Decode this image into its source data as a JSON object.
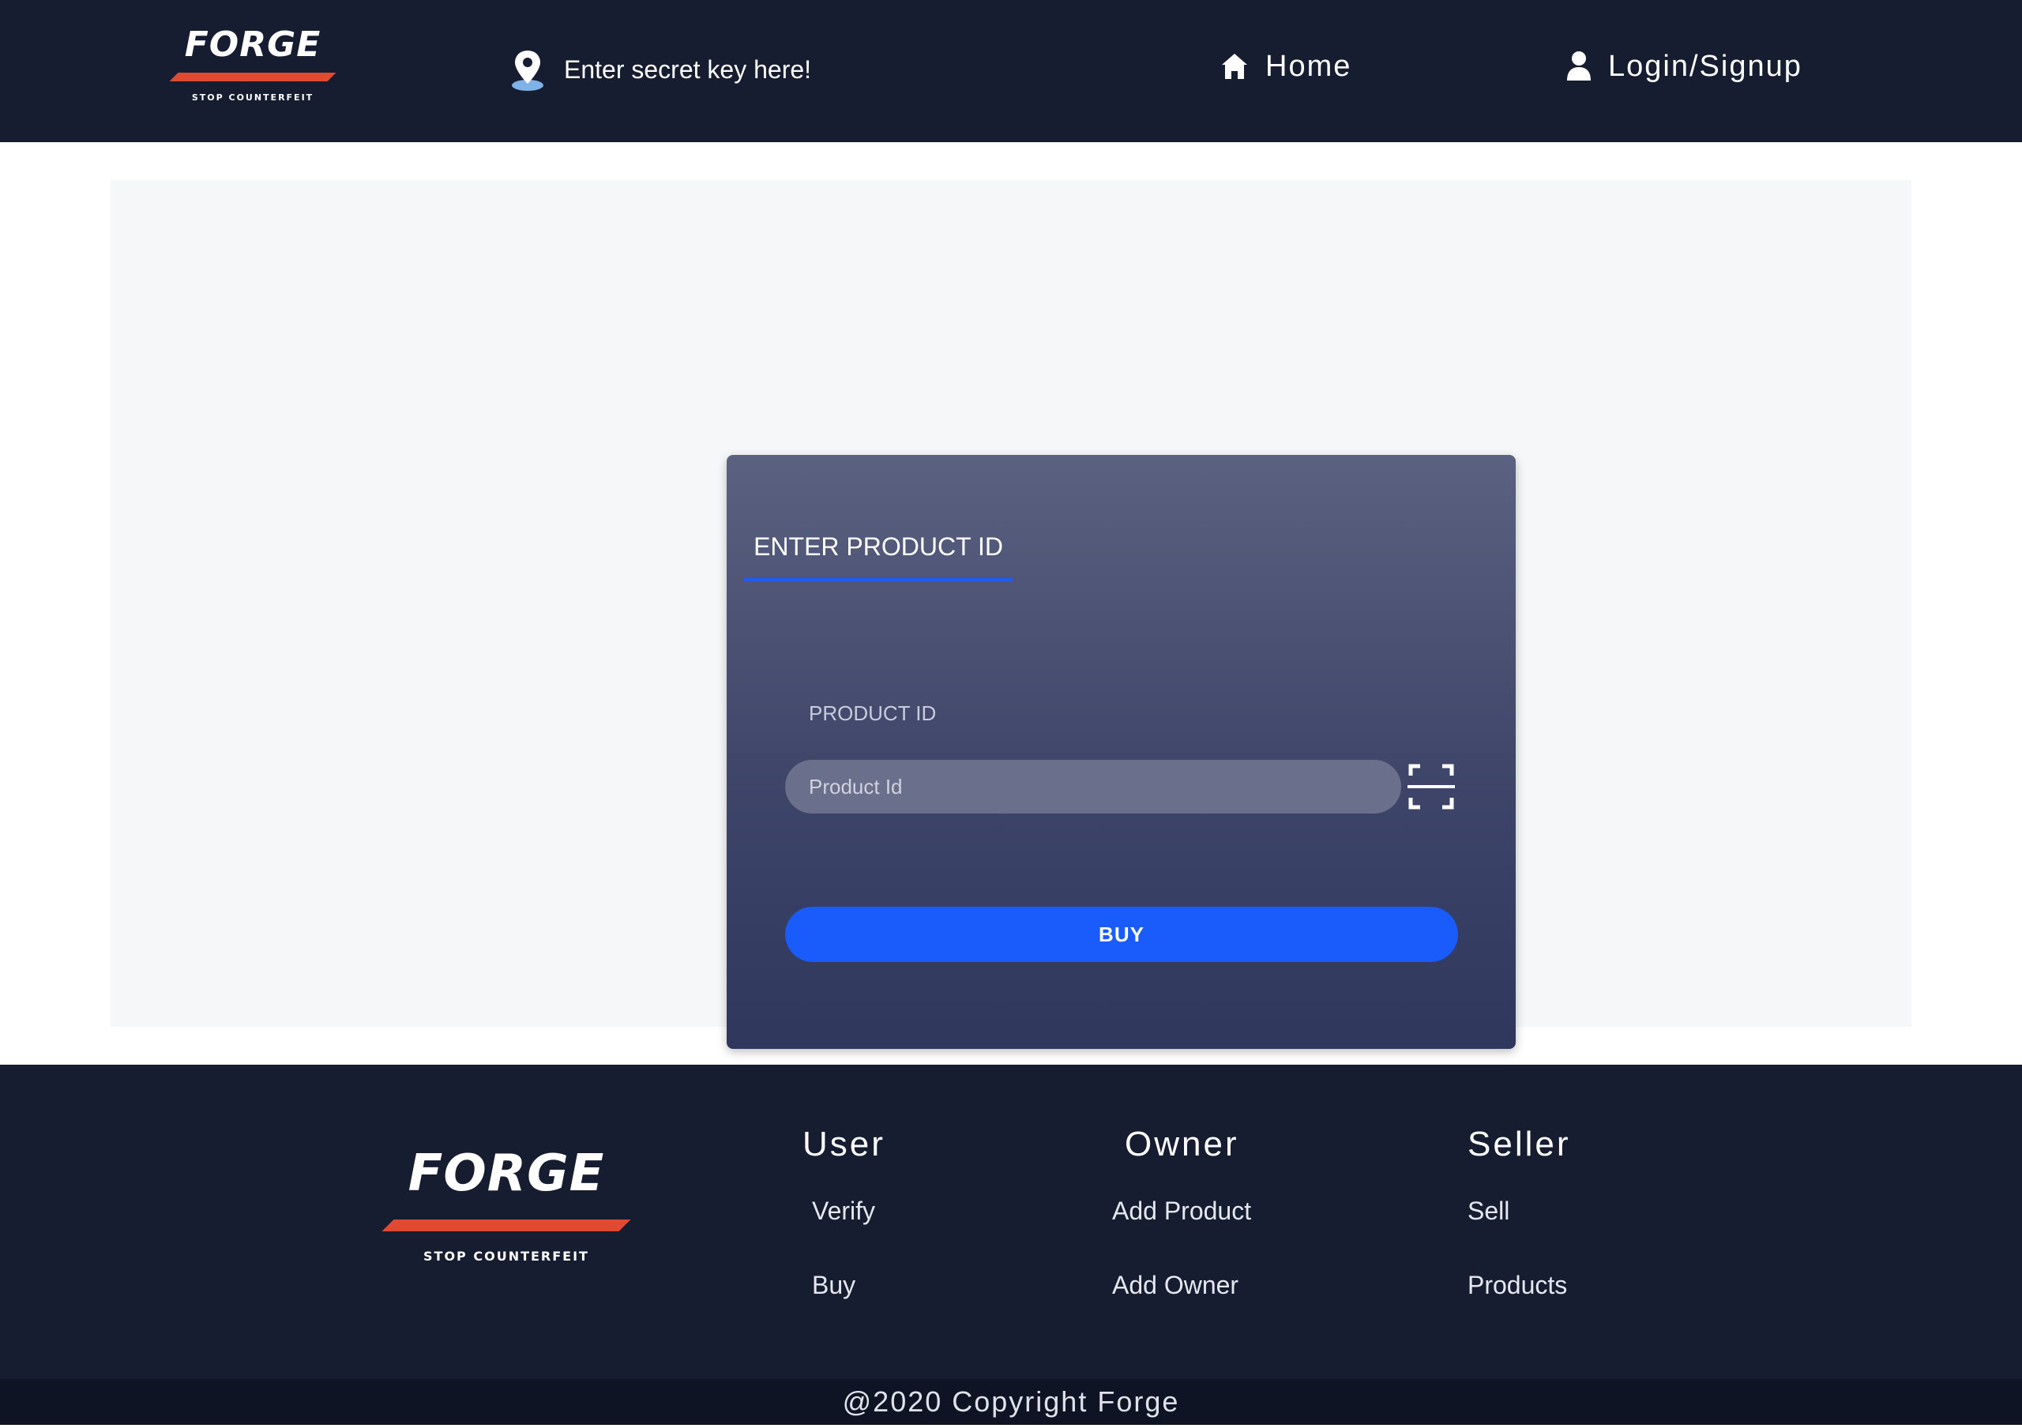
{
  "brand": {
    "name": "FORGE",
    "tagline": "STOP COUNTERFEIT",
    "accent_color": "#e04a32"
  },
  "header": {
    "secret_key_placeholder": "Enter secret key here!",
    "pin_icon": "location-pin-icon",
    "nav": [
      {
        "label": "Home",
        "icon": "home-icon"
      },
      {
        "label": "Login/Signup",
        "icon": "user-icon"
      }
    ]
  },
  "card": {
    "tab_label": "ENTER PRODUCT ID",
    "field_label": "PRODUCT ID",
    "input_placeholder": "Product Id",
    "input_value": "",
    "scan_icon": "qr-scan-icon",
    "buy_label": "BUY",
    "button_color": "#1a5cfb"
  },
  "footer": {
    "columns": [
      {
        "title": "User",
        "links": [
          "Verify",
          "Buy"
        ]
      },
      {
        "title": "Owner",
        "links": [
          "Add Product",
          "Add Owner"
        ]
      },
      {
        "title": "Seller",
        "links": [
          "Sell",
          "Products"
        ]
      }
    ],
    "copyright": "@2020 Copyright Forge"
  }
}
